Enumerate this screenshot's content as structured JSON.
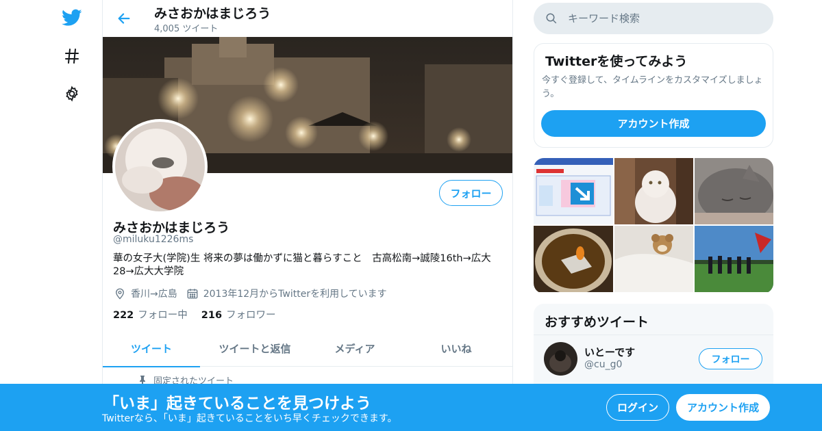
{
  "nav": {
    "items": [
      {
        "icon": "twitter-bird-icon"
      },
      {
        "icon": "hashtag-icon"
      },
      {
        "icon": "gear-icon"
      }
    ]
  },
  "header": {
    "name": "みさおかはまじろう",
    "tweet_count": "4,005 ツイート"
  },
  "profile": {
    "name": "みさおかはまじろう",
    "handle": "@miluku1226ms",
    "bio": "華の女子大(学院)生 将来の夢は働かずに猫と暮らすこと　古高松南→誠陵16th→広大28→広大大学院",
    "location": "香川→広島",
    "joined": "2013年12月からTwitterを利用しています",
    "following_count": "222",
    "following_label": "フォロー中",
    "followers_count": "216",
    "followers_label": "フォロワー",
    "follow_label": "フォロー"
  },
  "tabs": [
    {
      "label": "ツイート",
      "active": true
    },
    {
      "label": "ツイートと返信",
      "active": false
    },
    {
      "label": "メディア",
      "active": false
    },
    {
      "label": "いいね",
      "active": false
    }
  ],
  "pinned_label": "固定されたツイート",
  "search": {
    "placeholder": "キーワード検索"
  },
  "signup_card": {
    "title": "Twitterを使ってみよう",
    "description": "今すぐ登録して、タイムラインをカスタマイズしましょう。",
    "button": "アカウント作成"
  },
  "recommended": {
    "title": "おすすめツイート",
    "user": {
      "name": "いとーです",
      "handle": "@cu_g0",
      "follow_label": "フォロー"
    }
  },
  "bottom_bar": {
    "title": "「いま」起きていることを見つけよう",
    "subtitle": "Twitterなら、「いま」起きていることをいち早くチェックできます。",
    "login": "ログイン",
    "signup": "アカウント作成"
  },
  "colors": {
    "accent": "#1da1f2",
    "text": "#14171a",
    "secondary": "#657786",
    "border": "#e6ecf0"
  }
}
